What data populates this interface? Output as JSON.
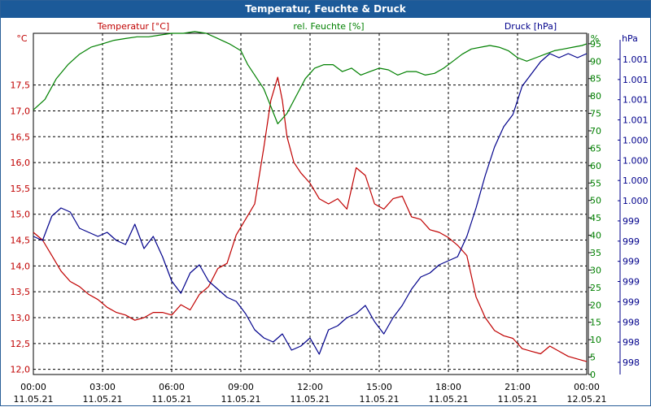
{
  "title": "Temperatur, Feuchte & Druck",
  "colors": {
    "temperature": "#c00000",
    "humidity": "#008000",
    "pressure": "#00008b",
    "title_bg": "#1c5a99"
  },
  "chart_data": {
    "type": "line",
    "x_ticks": [
      {
        "time": "00:00",
        "date": "11.05.21"
      },
      {
        "time": "03:00",
        "date": "11.05.21"
      },
      {
        "time": "06:00",
        "date": "11.05.21"
      },
      {
        "time": "09:00",
        "date": "11.05.21"
      },
      {
        "time": "12:00",
        "date": "11.05.21"
      },
      {
        "time": "15:00",
        "date": "11.05.21"
      },
      {
        "time": "18:00",
        "date": "11.05.21"
      },
      {
        "time": "21:00",
        "date": "11.05.21"
      },
      {
        "time": "00:00",
        "date": "12.05.21"
      }
    ],
    "xlim_hours": [
      0,
      24
    ],
    "grid": true,
    "axes": {
      "temperature": {
        "unit": "°C",
        "ylim": [
          11.9,
          18.5
        ],
        "ticks": [
          "12,0",
          "12,5",
          "13,0",
          "13,5",
          "14,0",
          "14,5",
          "15,0",
          "15,5",
          "16,0",
          "16,5",
          "17,0",
          "17,5"
        ],
        "tick_values": [
          12.0,
          12.5,
          13.0,
          13.5,
          14.0,
          14.5,
          15.0,
          15.5,
          16.0,
          16.5,
          17.0,
          17.5
        ]
      },
      "humidity": {
        "unit": "%",
        "ylim": [
          0,
          98
        ],
        "ticks": [
          "0",
          "5",
          "10",
          "15",
          "20",
          "25",
          "30",
          "35",
          "40",
          "45",
          "50",
          "55",
          "60",
          "65",
          "70",
          "75",
          "80",
          "85",
          "90",
          "95"
        ],
        "tick_values": [
          0,
          5,
          10,
          15,
          20,
          25,
          30,
          35,
          40,
          45,
          50,
          55,
          60,
          65,
          70,
          75,
          80,
          85,
          90,
          95
        ]
      },
      "pressure": {
        "unit": "hPa",
        "ticks": [
          "998",
          "998",
          "998",
          "999",
          "999",
          "999",
          "999",
          "999",
          "1.000",
          "1.000",
          "1.000",
          "1.000",
          "1.001",
          "1.001",
          "1.001",
          "1.001"
        ]
      }
    },
    "series": [
      {
        "name": "Temperatur [°C]",
        "axis": "temperature",
        "x": [
          0,
          0.4,
          0.8,
          1.2,
          1.6,
          2,
          2.4,
          2.8,
          3.2,
          3.6,
          4,
          4.4,
          4.8,
          5.2,
          5.6,
          6,
          6.4,
          6.8,
          7.2,
          7.6,
          8,
          8.4,
          8.8,
          9.2,
          9.6,
          10,
          10.3,
          10.6,
          10.8,
          11,
          11.3,
          11.6,
          12,
          12.4,
          12.8,
          13.2,
          13.6,
          14,
          14.4,
          14.8,
          15.2,
          15.6,
          16,
          16.4,
          16.8,
          17.2,
          17.6,
          18,
          18.4,
          18.8,
          19.2,
          19.6,
          20,
          20.4,
          20.8,
          21.2,
          21.6,
          22,
          22.4,
          22.8,
          23.2,
          23.6,
          24
        ],
        "values": [
          14.65,
          14.5,
          14.2,
          13.9,
          13.7,
          13.6,
          13.45,
          13.35,
          13.2,
          13.1,
          13.05,
          12.95,
          13.0,
          13.1,
          13.1,
          13.05,
          13.25,
          13.15,
          13.45,
          13.6,
          13.95,
          14.05,
          14.6,
          14.9,
          15.2,
          16.3,
          17.2,
          17.65,
          17.2,
          16.5,
          16.0,
          15.8,
          15.6,
          15.3,
          15.2,
          15.3,
          15.1,
          15.9,
          15.75,
          15.2,
          15.1,
          15.3,
          15.35,
          14.95,
          14.9,
          14.7,
          14.65,
          14.55,
          14.4,
          14.2,
          13.4,
          13.0,
          12.75,
          12.65,
          12.6,
          12.4,
          12.35,
          12.3,
          12.45,
          12.35,
          12.25,
          12.2,
          12.15
        ]
      },
      {
        "name": "rel. Feuchte [%]",
        "axis": "humidity",
        "x": [
          0,
          0.5,
          1,
          1.5,
          2,
          2.5,
          3,
          3.5,
          4,
          4.5,
          5,
          5.5,
          6,
          6.5,
          7,
          7.5,
          8,
          8.5,
          9,
          9.3,
          9.6,
          10,
          10.3,
          10.6,
          11,
          11.4,
          11.8,
          12.2,
          12.6,
          13,
          13.4,
          13.8,
          14.2,
          14.6,
          15,
          15.4,
          15.8,
          16.2,
          16.6,
          17,
          17.4,
          17.8,
          18.2,
          18.6,
          19,
          19.4,
          19.8,
          20.2,
          20.6,
          21,
          21.4,
          21.8,
          22.2,
          22.6,
          23,
          23.4,
          23.8,
          24
        ],
        "values": [
          76,
          79,
          85,
          89,
          92,
          94,
          95,
          96,
          96.5,
          97,
          97,
          97.5,
          98,
          98,
          98.5,
          98,
          96.5,
          95,
          93,
          89,
          86,
          82,
          77,
          72,
          75,
          80,
          85,
          88,
          89,
          89,
          87,
          88,
          86,
          87,
          88,
          87.5,
          86,
          87,
          87,
          86,
          86.5,
          88,
          90,
          92,
          93.5,
          94,
          94.5,
          94,
          93,
          91,
          90,
          91,
          92,
          93,
          93.5,
          94,
          94.5,
          95
        ]
      },
      {
        "name": "Druck [hPa]",
        "axis": "pressure",
        "x": [
          0,
          0.4,
          0.8,
          1.2,
          1.6,
          2,
          2.4,
          2.8,
          3.2,
          3.6,
          4,
          4.4,
          4.8,
          5.2,
          5.6,
          6,
          6.4,
          6.8,
          7.2,
          7.6,
          8,
          8.4,
          8.8,
          9.2,
          9.6,
          10,
          10.4,
          10.8,
          11.2,
          11.6,
          12,
          12.4,
          12.8,
          13.2,
          13.6,
          14,
          14.4,
          14.8,
          15.2,
          15.6,
          16,
          16.4,
          16.8,
          17.2,
          17.6,
          18,
          18.4,
          18.8,
          19.2,
          19.6,
          20,
          20.4,
          20.8,
          21.2,
          21.6,
          22,
          22.4,
          22.8,
          23.2,
          23.6,
          24
        ],
        "values": [
          998.55,
          998.5,
          998.8,
          998.9,
          998.85,
          998.65,
          998.6,
          998.55,
          998.6,
          998.5,
          998.45,
          998.7,
          998.4,
          998.55,
          998.3,
          998.0,
          997.85,
          998.1,
          998.2,
          998.0,
          997.9,
          997.8,
          997.75,
          997.6,
          997.4,
          997.3,
          997.25,
          997.35,
          997.15,
          997.2,
          997.3,
          997.1,
          997.4,
          997.45,
          997.55,
          997.6,
          997.7,
          997.5,
          997.35,
          997.55,
          997.7,
          997.9,
          998.05,
          998.1,
          998.2,
          998.25,
          998.3,
          998.55,
          998.9,
          999.3,
          999.65,
          999.9,
          1000.05,
          1000.4,
          1000.55,
          1000.7,
          1000.8,
          1000.75,
          1000.8,
          1000.75,
          1000.8
        ]
      }
    ],
    "legend": [
      "Temperatur [°C]",
      "rel. Feuchte [%]",
      "Druck [hPa]"
    ]
  }
}
